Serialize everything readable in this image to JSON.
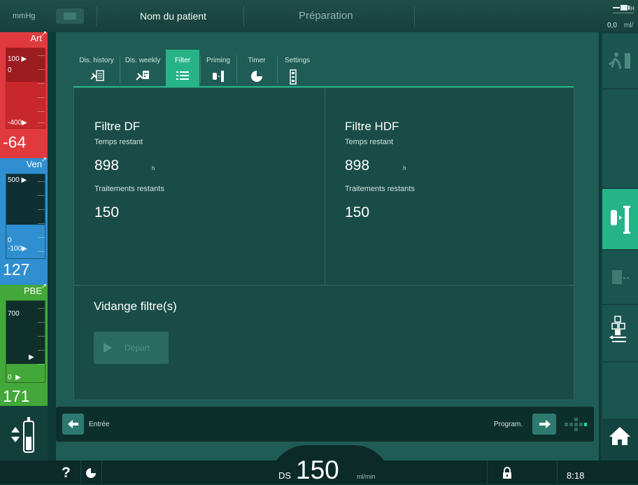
{
  "header": {
    "pressure_unit": "mmHg",
    "patient_name": "Nom du patient",
    "phase": "Préparation",
    "flow_value": "0,0",
    "flow_unit": "ml/"
  },
  "pressures": {
    "art": {
      "label": "Art",
      "upper": "100",
      "upper_sub": "0",
      "lower": "-400",
      "value": "-64",
      "color": "#e03a3e"
    },
    "ven": {
      "label": "Ven",
      "upper": "500",
      "lower_a": "0",
      "lower_b": "-100",
      "value": "127",
      "color": "#2f8fd0"
    },
    "pbe": {
      "label": "PBE",
      "upper": "700",
      "lower": "0",
      "value": "171",
      "color": "#43a83a"
    }
  },
  "tabs": [
    {
      "label": "Dis. history",
      "icon": "disinfection-history-icon"
    },
    {
      "label": "Dis. weekly",
      "icon": "disinfection-weekly-icon"
    },
    {
      "label": "Filter",
      "icon": "filter-list-icon"
    },
    {
      "label": "Priming",
      "icon": "priming-icon"
    },
    {
      "label": "Timer",
      "icon": "timer-icon"
    },
    {
      "label": "Settings",
      "icon": "settings-device-icon"
    }
  ],
  "filters": {
    "df": {
      "title": "Filtre DF",
      "time_label": "Temps restant",
      "time_value": "898",
      "time_unit": "h",
      "treat_label": "Traitements restants",
      "treat_value": "150"
    },
    "hdf": {
      "title": "Filtre HDF",
      "time_label": "Temps restant",
      "time_value": "898",
      "time_unit": "h",
      "treat_label": "Traitements restants",
      "treat_value": "150"
    }
  },
  "drain": {
    "title": "Vidange filtre(s)",
    "start_label": "Départ"
  },
  "nav": {
    "prev_label": "Entrée",
    "next_label": "Program."
  },
  "status": {
    "help": "?",
    "ds_label": "DS",
    "ds_value": "150",
    "ds_unit": "ml/min",
    "time": "8:18"
  },
  "colors": {
    "accent": "#26b487",
    "background": "#1f5c55"
  }
}
